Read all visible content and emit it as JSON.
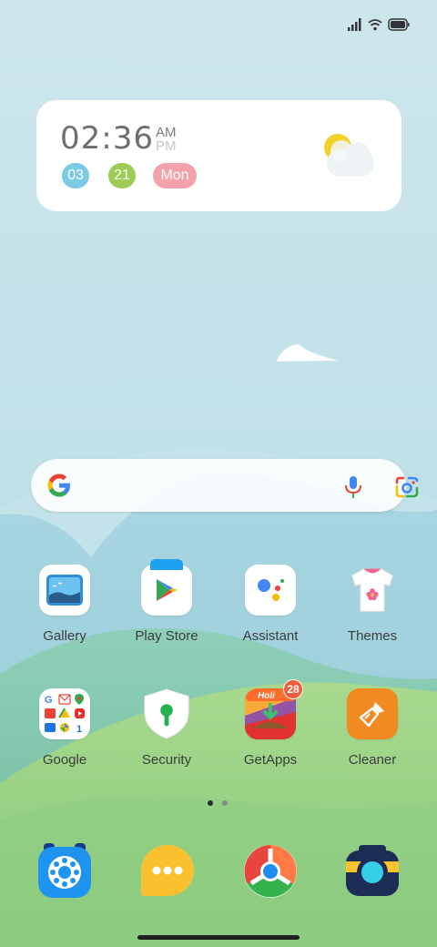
{
  "status_bar": {
    "icons": [
      "signal-icon",
      "wifi-icon",
      "battery-icon"
    ]
  },
  "clock_widget": {
    "time": "02:36",
    "am": "AM",
    "pm": "PM",
    "month": "03",
    "day": "21",
    "weekday": "Mon",
    "colors": {
      "month": "#7ccbe4",
      "day": "#9ccc55",
      "weekday": "#f3a1ab"
    }
  },
  "search_bar": {
    "icons": [
      "google-g-icon",
      "microphone-icon",
      "google-lens-icon"
    ]
  },
  "apps": [
    {
      "label": "Gallery",
      "icon": "gallery-icon"
    },
    {
      "label": "Play Store",
      "icon": "play-store-icon"
    },
    {
      "label": "Assistant",
      "icon": "assistant-icon"
    },
    {
      "label": "Themes",
      "icon": "themes-icon"
    },
    {
      "label": "Google",
      "icon": "google-folder-icon"
    },
    {
      "label": "Security",
      "icon": "security-icon"
    },
    {
      "label": "GetApps",
      "icon": "getapps-icon",
      "badge": "28",
      "banner": "Holi"
    },
    {
      "label": "Cleaner",
      "icon": "cleaner-icon"
    }
  ],
  "page_indicator": {
    "pages": 2,
    "current": 1
  },
  "dock": [
    "phone-icon",
    "messages-icon",
    "browser-icon",
    "camera-icon"
  ]
}
